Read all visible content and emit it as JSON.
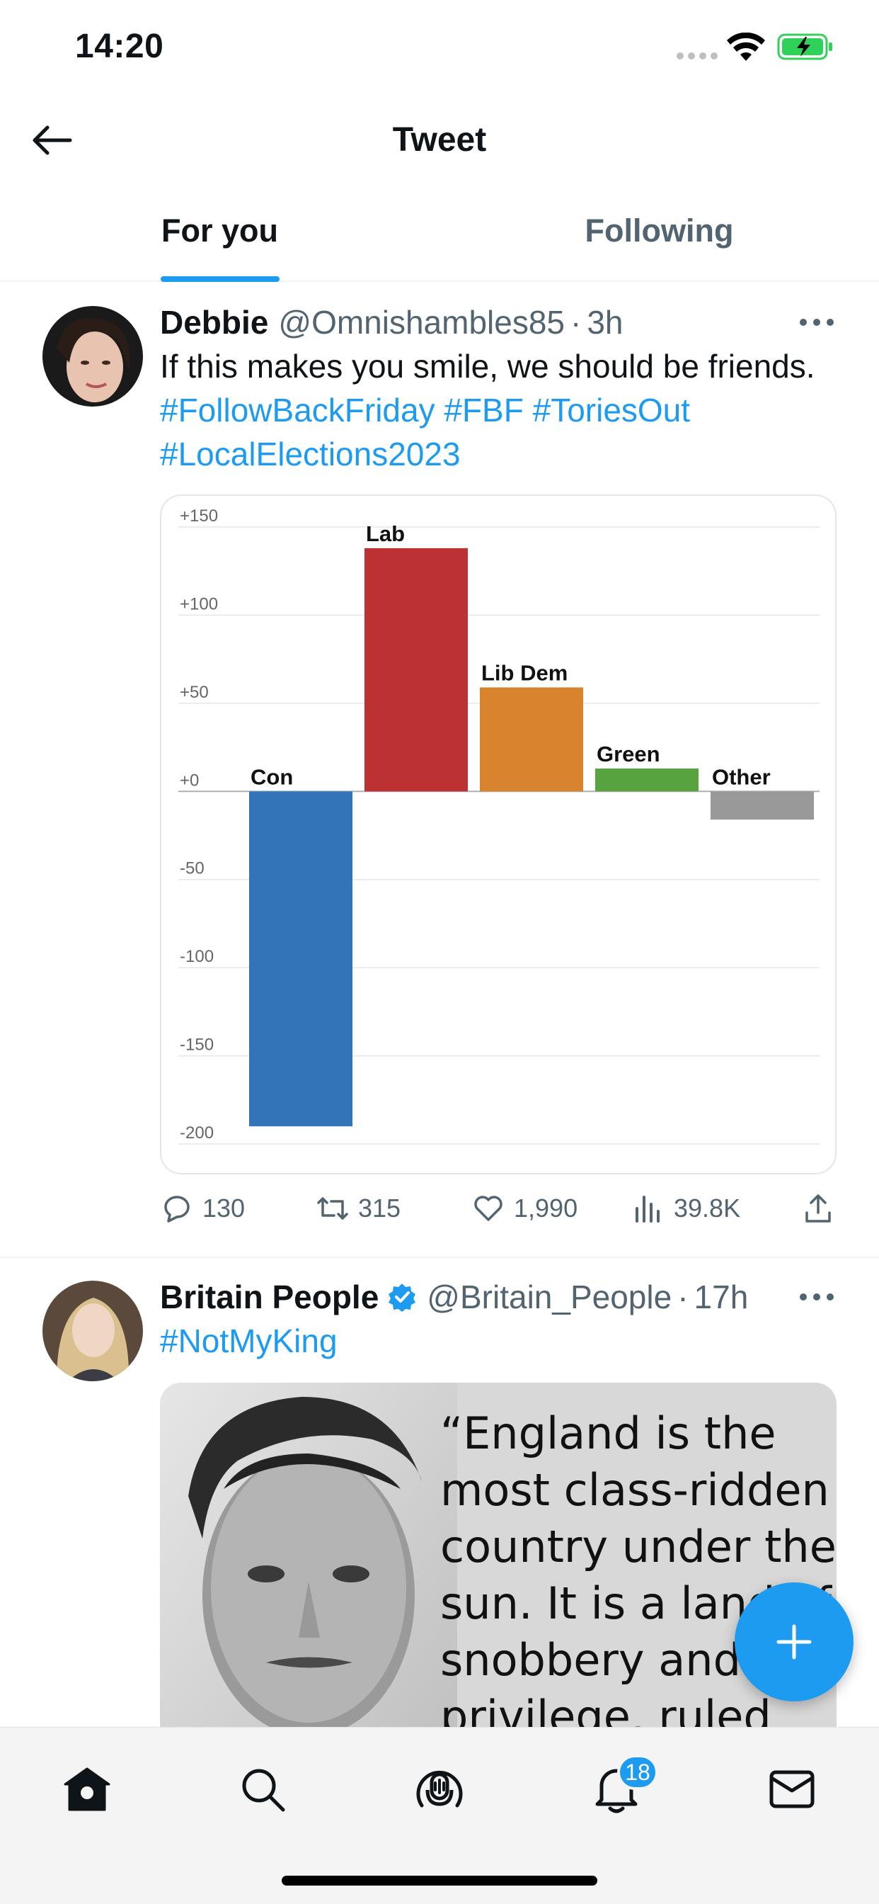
{
  "status_bar": {
    "time": "14:20",
    "icons": [
      "signal-dots-icon",
      "wifi-icon",
      "battery-charging-icon"
    ],
    "battery_color": "#30d158"
  },
  "header": {
    "back_icon": "arrow-left-icon",
    "title": "Tweet"
  },
  "tabs": [
    {
      "label": "For you",
      "active": true
    },
    {
      "label": "Following",
      "active": false
    }
  ],
  "accent_color": "#1d9bf0",
  "tweets": [
    {
      "name": "Debbie",
      "handle": "@Omnishambles85",
      "dot": "·",
      "time": "3h",
      "text_parts": [
        "If this makes you smile, we should be friends. ",
        "#FollowBackFriday",
        " ",
        "#FBF",
        " ",
        "#ToriesOut",
        " ",
        "#LocalElections2023"
      ],
      "actions": {
        "replies": "130",
        "retweets": "315",
        "likes": "1,990",
        "views": "39.8K"
      }
    },
    {
      "name": "Britain People",
      "verified": true,
      "handle": "@Britain_People",
      "dot": "·",
      "time": "17h",
      "hashtag": "#NotMyKing",
      "image_quote": "“England is the most class-ridden country under the sun. It is a land of snobbery and privilege, ruled"
    }
  ],
  "chart_data": {
    "type": "bar",
    "categories": [
      "Con",
      "Lab",
      "Lib Dem",
      "Green",
      "Other"
    ],
    "values": [
      -190,
      138,
      59,
      13,
      -16
    ],
    "colors": [
      "#3274b7",
      "#bc3131",
      "#d8832e",
      "#56a33f",
      "#999999"
    ],
    "ylim": [
      -200,
      150
    ],
    "yticks": [
      "+150",
      "+100",
      "+50",
      "+0",
      "-50",
      "-100",
      "-150",
      "-200"
    ],
    "ytick_values": [
      150,
      100,
      50,
      0,
      -50,
      -100,
      -150,
      -200
    ],
    "grid": true
  },
  "fab": {
    "icon": "plus-icon"
  },
  "bottom_nav": [
    {
      "icon": "home-icon",
      "active": true
    },
    {
      "icon": "search-icon"
    },
    {
      "icon": "spaces-icon"
    },
    {
      "icon": "bell-icon",
      "badge": "18"
    },
    {
      "icon": "mail-icon"
    }
  ]
}
